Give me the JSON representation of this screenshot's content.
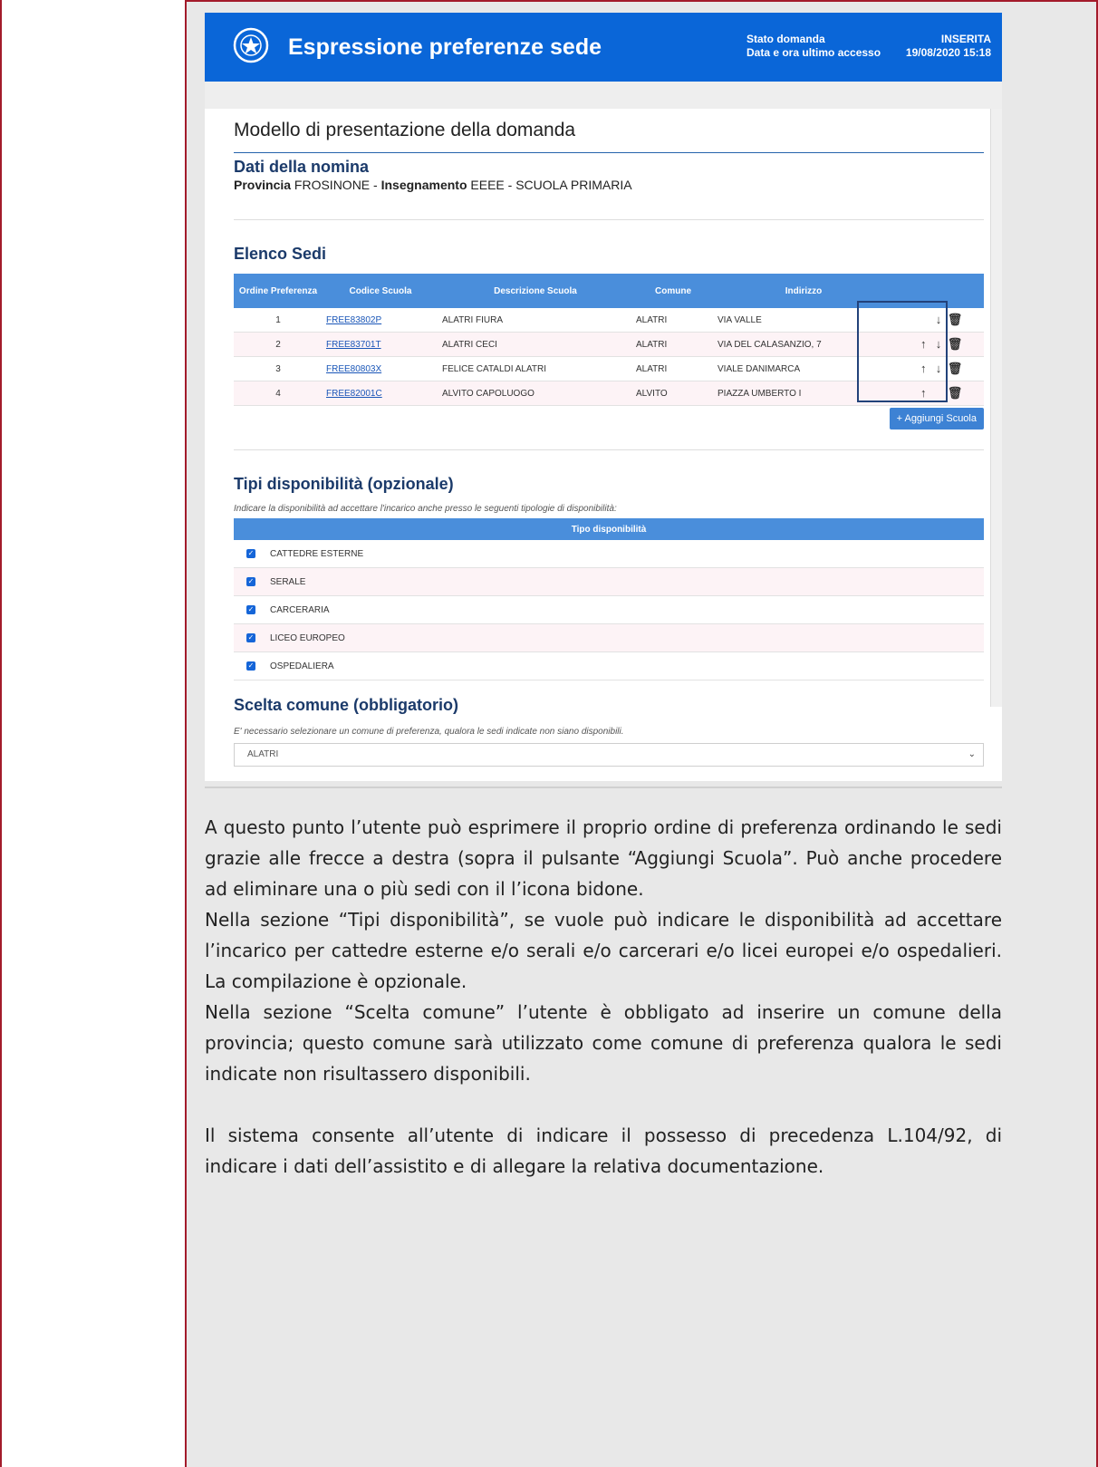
{
  "header": {
    "title": "Espressione preferenze sede",
    "stato_label": "Stato domanda",
    "accesso_label": "Data e ora ultimo accesso",
    "stato_value": "INSERITA",
    "accesso_value": "19/08/2020 15:18"
  },
  "form": {
    "title": "Modello di presentazione della domanda",
    "nomina": {
      "title": "Dati della nomina",
      "provincia_label": "Provincia",
      "provincia_value": "FROSINONE",
      "separator": "-",
      "insegnamento_label": "Insegnamento",
      "insegnamento_value": "EEEE - SCUOLA PRIMARIA"
    },
    "sedi": {
      "title": "Elenco Sedi",
      "columns": [
        "Ordine Preferenza",
        "Codice Scuola",
        "Descrizione Scuola",
        "Comune",
        "Indirizzo"
      ],
      "rows": [
        {
          "ordine": "1",
          "codice": "FREE83802P",
          "descrizione": "ALATRI FIURA",
          "comune": "ALATRI",
          "indirizzo": "VIA VALLE"
        },
        {
          "ordine": "2",
          "codice": "FREE83701T",
          "descrizione": "ALATRI CECI",
          "comune": "ALATRI",
          "indirizzo": "VIA DEL CALASANZIO, 7"
        },
        {
          "ordine": "3",
          "codice": "FREE80803X",
          "descrizione": "FELICE CATALDI ALATRI",
          "comune": "ALATRI",
          "indirizzo": "VIALE DANIMARCA"
        },
        {
          "ordine": "4",
          "codice": "FREE82001C",
          "descrizione": "ALVITO CAPOLUOGO",
          "comune": "ALVITO",
          "indirizzo": "PIAZZA UMBERTO I"
        }
      ],
      "up_glyph": "↑",
      "down_glyph": "↓",
      "trash_glyph": "🗑",
      "add_button": "+ Aggiungi Scuola"
    },
    "tipi": {
      "title": "Tipi disponibilità (opzionale)",
      "note": "Indicare la disponibilità ad accettare l'incarico anche presso le seguenti tipologie di disponibilità:",
      "column": "Tipo disponibilità",
      "items": [
        "CATTEDRE ESTERNE",
        "SERALE",
        "CARCERARIA",
        "LICEO EUROPEO",
        "OSPEDALIERA"
      ],
      "check_glyph": "✓"
    },
    "comune": {
      "title": "Scelta comune (obbligatorio)",
      "note": "E' necessario selezionare un comune di preferenza, qualora le sedi indicate non siano disponibili.",
      "selected": "ALATRI",
      "caret": "⌄"
    }
  },
  "doc": {
    "p1": "A questo punto l’utente può esprimere il proprio ordine di preferenza ordinando le sedi grazie alle frecce a destra (sopra il pulsante “Aggiungi Scuola”. Può anche procedere ad eliminare una o più sedi con il l’icona bidone.",
    "p2": "Nella sezione “Tipi disponibilità”, se vuole può indicare le disponibilità ad accettare l’incarico per cattedre esterne e/o serali e/o carcerari e/o licei europei e/o ospedalieri. La compilazione è opzionale.",
    "p3": "Nella sezione “Scelta comune” l’utente è obbligato ad inserire un comune della provincia; questo comune sarà utilizzato come comune di preferenza qualora le sedi indicate non risultassero disponibili.",
    "p4": "Il sistema consente all’utente di indicare il possesso di precedenza L.104/92, di indicare i dati dell’assistito e di allegare la relativa documentazione."
  },
  "colors": {
    "header_blue": "#0a66d8",
    "table_blue": "#4a8edb",
    "frame_red": "#a31b2b"
  }
}
